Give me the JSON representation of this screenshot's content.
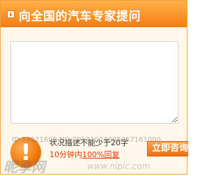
{
  "header": {
    "title": "向全国的汽车专家提问",
    "arrow_icon": "arrow-right-icon"
  },
  "question": {
    "value": "",
    "placeholder": ""
  },
  "footer": {
    "warning_icon": "exclamation-icon",
    "hint_min_chars": "状况描述不能少于20字",
    "hint_reply_prefix": "10分钟内",
    "hint_reply_emphasis": "100%回复",
    "submit_label": "立即咨询"
  },
  "watermark": {
    "id_text": "ID:12621600 NO:20121024095057161000",
    "brand": "昵享网",
    "url": "www.nipic.com"
  },
  "colors": {
    "accent": "#f37d12",
    "panel_bg": "#fff8ea",
    "hint_red": "#e03a00"
  }
}
